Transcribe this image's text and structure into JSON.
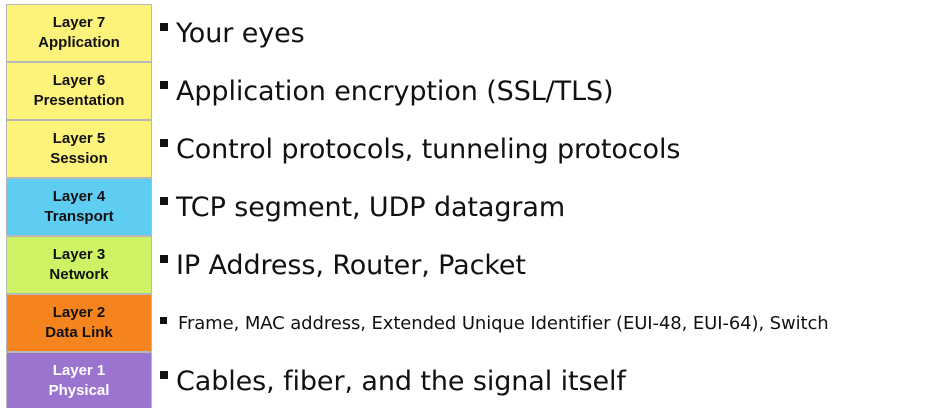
{
  "layers": [
    {
      "number_label": "Layer 7",
      "name": "Application",
      "description": "Your eyes",
      "color": "#fdf27a",
      "text_color": "#111111"
    },
    {
      "number_label": "Layer 6",
      "name": "Presentation",
      "description": "Application encryption (SSL/TLS)",
      "color": "#fdf27a",
      "text_color": "#111111"
    },
    {
      "number_label": "Layer 5",
      "name": "Session",
      "description": "Control protocols, tunneling protocols",
      "color": "#fdf27a",
      "text_color": "#111111"
    },
    {
      "number_label": "Layer 4",
      "name": "Transport",
      "description": "TCP segment, UDP datagram",
      "color": "#5fcdf2",
      "text_color": "#111111"
    },
    {
      "number_label": "Layer 3",
      "name": "Network",
      "description": "IP Address, Router, Packet",
      "color": "#cdf263",
      "text_color": "#111111"
    },
    {
      "number_label": "Layer 2",
      "name": "Data Link",
      "description": "Frame, MAC address, Extended Unique Identifier (EUI-48, EUI-64), Switch",
      "color": "#f5841f",
      "text_color": "#111111"
    },
    {
      "number_label": "Layer 1",
      "name": "Physical",
      "description": "Cables, fiber, and the signal itself",
      "color": "#9b74d0",
      "text_color": "#ffffff"
    }
  ]
}
